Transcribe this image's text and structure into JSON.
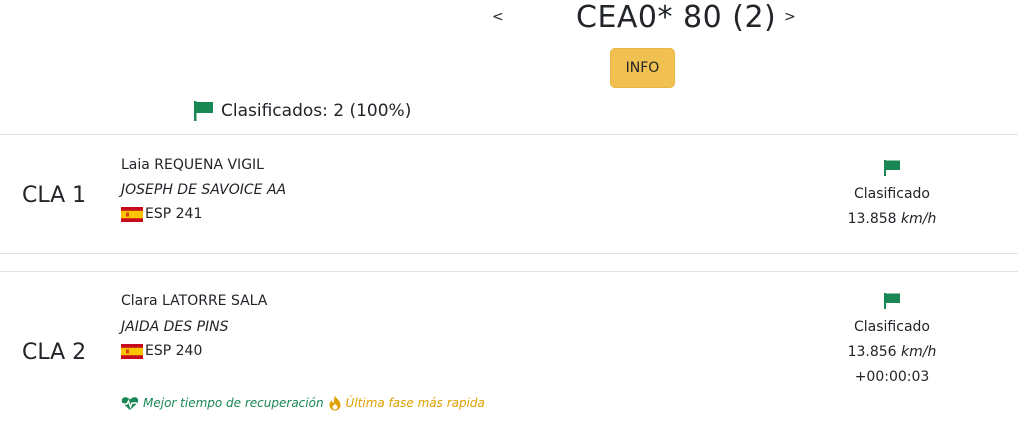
{
  "header": {
    "prev_label": "<",
    "title": "CEA0* 80 (2)",
    "next_label": ">",
    "info_label": "INFO"
  },
  "summary": {
    "text": "Clasificados: 2 (100%)",
    "flag_color": "#198754"
  },
  "results": [
    {
      "position": "CLA 1",
      "rider": "Laia REQUENA VIGIL",
      "horse": "JOSEPH DE SAVOICE AA",
      "nation": "ESP 241",
      "status": "Clasificado",
      "speed": "13.858",
      "speed_unit": "km/h"
    },
    {
      "position": "CLA 2",
      "rider": "Clara LATORRE SALA",
      "horse": "JAIDA DES PINS",
      "nation": "ESP 240",
      "status": "Clasificado",
      "speed": "13.856",
      "speed_unit": "km/h",
      "gap": "+00:00:03",
      "badges": {
        "recovery": "Mejor tiempo de recuperación",
        "recovery_icon": "heartbeat-icon",
        "recovery_color": "#198754",
        "fastest": "Última fase más rapida",
        "fastest_icon": "fire-icon",
        "fastest_color": "#e0a100"
      }
    }
  ]
}
